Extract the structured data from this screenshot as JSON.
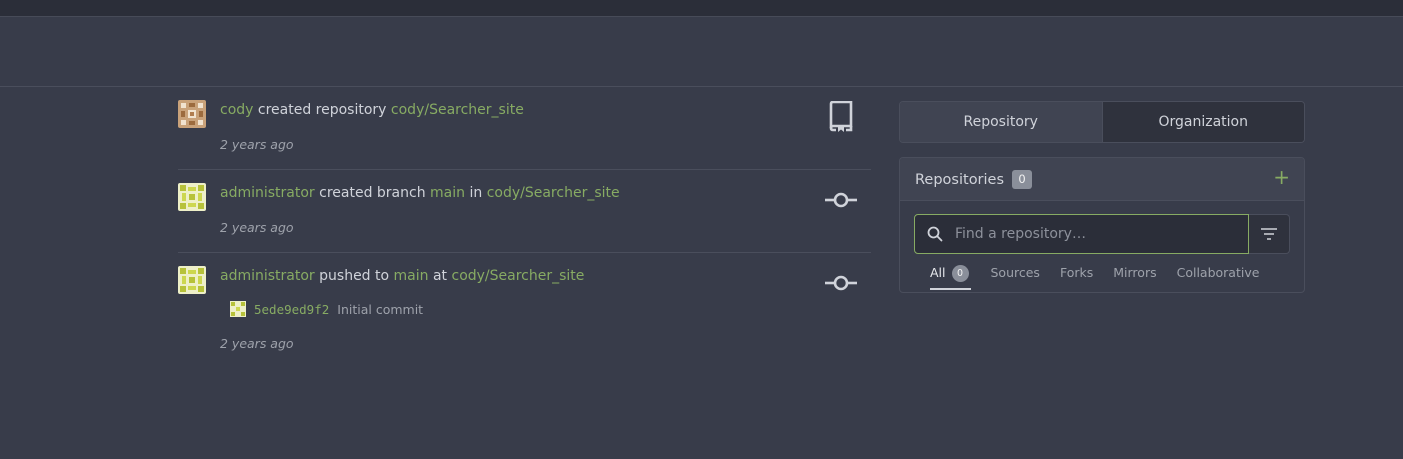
{
  "feed": {
    "items": [
      {
        "user": "cody",
        "action": "created repository",
        "repo": "cody/Searcher_site",
        "time": "2 years ago",
        "icon": "repo-bookmark-icon"
      },
      {
        "user": "administrator",
        "action": "created branch",
        "branch": "main",
        "conj": "in",
        "repo": "cody/Searcher_site",
        "time": "2 years ago",
        "icon": "commit-icon"
      },
      {
        "user": "administrator",
        "action": "pushed to",
        "branch": "main",
        "conj": "at",
        "repo": "cody/Searcher_site",
        "commit": {
          "sha": "5ede9ed9f2",
          "message": "Initial commit"
        },
        "time": "2 years ago",
        "icon": "commit-icon"
      }
    ]
  },
  "switcher": {
    "tabs": [
      "Repository",
      "Organization"
    ]
  },
  "repos": {
    "title": "Repositories",
    "count": "0",
    "plus": "+",
    "search_placeholder": "Find a repository…",
    "filters": [
      {
        "label": "All",
        "count": "0"
      },
      {
        "label": "Sources"
      },
      {
        "label": "Forks"
      },
      {
        "label": "Mirrors"
      },
      {
        "label": "Collaborative"
      }
    ]
  },
  "colors": {
    "background": "#383c4a",
    "link": "#87ab63",
    "text": "#d0d3da",
    "muted": "#9ea2ab"
  }
}
